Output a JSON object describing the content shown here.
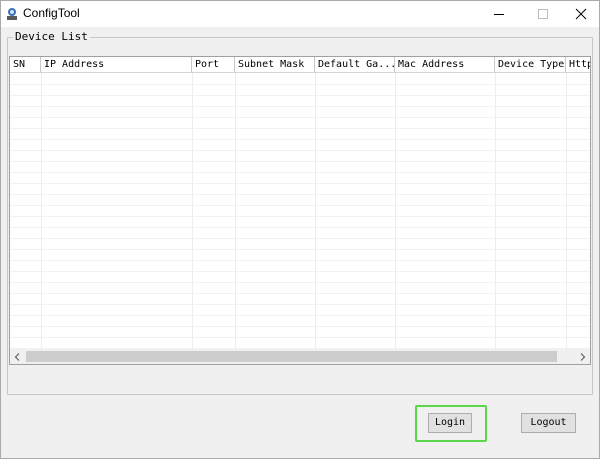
{
  "window": {
    "title": "ConfigTool"
  },
  "icons": {
    "app": "configtool-app-icon",
    "minimize": "minimize-icon",
    "maximize": "maximize-icon",
    "close": "close-icon",
    "scroll_left": "chevron-left-icon",
    "scroll_right": "chevron-right-icon"
  },
  "device_list": {
    "group_label": "Device List",
    "columns": [
      "SN",
      "IP Address",
      "Port",
      "Subnet Mask",
      "Default Ga...",
      "Mac Address",
      "Device Type",
      "Http"
    ],
    "rows": []
  },
  "buttons": {
    "login": "Login",
    "logout": "Logout"
  },
  "highlight_color": "#5bd64a"
}
